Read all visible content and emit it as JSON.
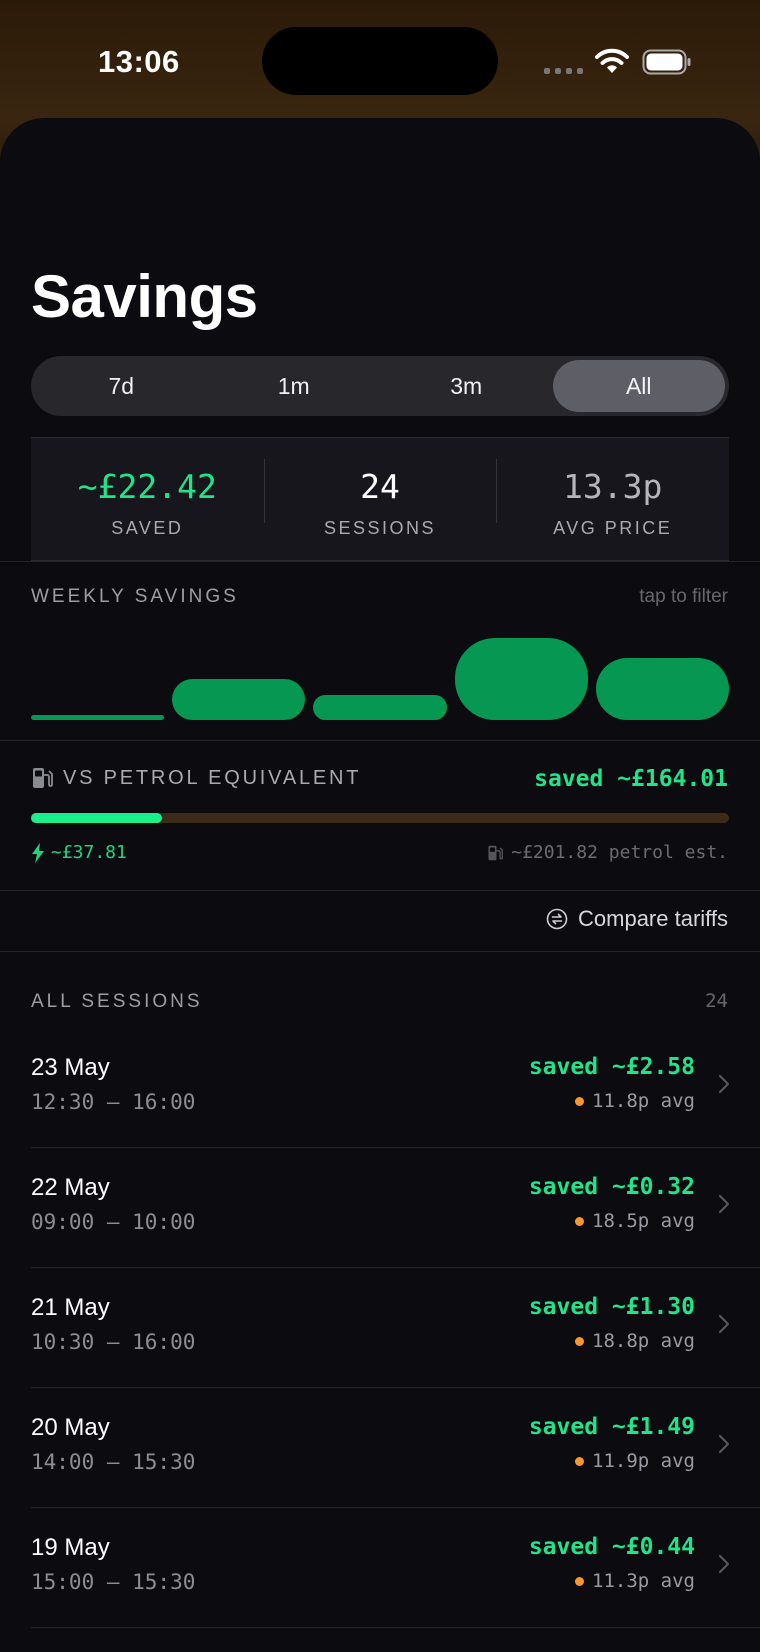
{
  "status": {
    "time": "13:06"
  },
  "title": "Savings",
  "ranges": [
    {
      "label": "7d",
      "active": false
    },
    {
      "label": "1m",
      "active": false
    },
    {
      "label": "3m",
      "active": false
    },
    {
      "label": "All",
      "active": true
    }
  ],
  "stats": [
    {
      "value": "~£22.42",
      "label": "SAVED",
      "color": "#1fe58a"
    },
    {
      "value": "24",
      "label": "SESSIONS",
      "color": "#ffffff"
    },
    {
      "value": "13.3p",
      "label": "AVG PRICE",
      "color": "#b5b5bc"
    }
  ],
  "weekly": {
    "label": "WEEKLY SAVINGS",
    "hint": "tap to filter",
    "relative_values": [
      0.06,
      0.5,
      0.3,
      1.0,
      0.76
    ]
  },
  "petrol": {
    "label": "VS PETROL EQUIVALENT",
    "saved": "saved ~£164.01",
    "ev_cost": "~£37.81",
    "petrol_estimate": "~£201.82 petrol est.",
    "ev_fraction": 0.187,
    "fill_color": "#19f08a",
    "track_color": "#3b2a16"
  },
  "compare_label": "Compare tariffs",
  "sessions_header": {
    "label": "ALL SESSIONS",
    "count": "24"
  },
  "sessions": [
    {
      "date": "23 May",
      "time": "12:30 — 16:00",
      "saved": "saved ~£2.58",
      "avg": "11.8p avg"
    },
    {
      "date": "22 May",
      "time": "09:00 — 10:00",
      "saved": "saved ~£0.32",
      "avg": "18.5p avg"
    },
    {
      "date": "21 May",
      "time": "10:30 — 16:00",
      "saved": "saved ~£1.30",
      "avg": "18.8p avg"
    },
    {
      "date": "20 May",
      "time": "14:00 — 15:30",
      "saved": "saved ~£1.49",
      "avg": "11.9p avg"
    },
    {
      "date": "19 May",
      "time": "15:00 — 15:30",
      "saved": "saved ~£0.44",
      "avg": "11.3p avg"
    }
  ],
  "colors": {
    "accent": "#1fe58a",
    "bar": "#069852",
    "dot": "#f49a2a"
  }
}
